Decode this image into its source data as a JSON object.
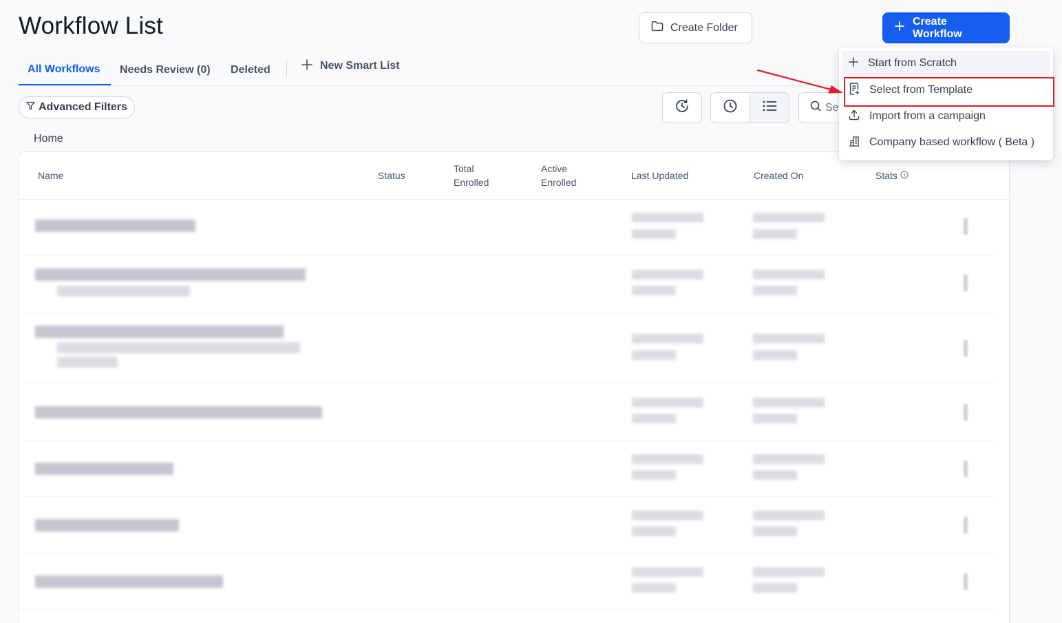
{
  "page": {
    "title": "Workflow List"
  },
  "actions": {
    "create_folder": "Create Folder",
    "create_workflow": "Create Workflow"
  },
  "tabs": [
    {
      "label": "All Workflows",
      "active": true
    },
    {
      "label": "Needs Review (0)",
      "active": false
    },
    {
      "label": "Deleted",
      "active": false
    },
    {
      "label": "New Smart List",
      "active": false
    }
  ],
  "filters": {
    "advanced": "Advanced Filters"
  },
  "search": {
    "visible_text": "Se"
  },
  "breadcrumb": {
    "home": "Home"
  },
  "table": {
    "columns": {
      "name": "Name",
      "status": "Status",
      "total_enrolled": "Total\nEnrolled",
      "active_enrolled": "Active\nEnrolled",
      "last_updated": "Last Updated",
      "created_on": "Created On",
      "stats": "Stats"
    },
    "rows_note_blurred": true
  },
  "dropdown": {
    "items": [
      {
        "label": "Start from Scratch",
        "icon": "plus-icon",
        "hovered": true
      },
      {
        "label": "Select from Template",
        "icon": "template-icon",
        "highlighted": true
      },
      {
        "label": "Import from a campaign",
        "icon": "upload-icon"
      },
      {
        "label": "Company based workflow ( Beta )",
        "icon": "building-icon"
      }
    ]
  },
  "colors": {
    "primary": "#155eef",
    "highlight": "#e01b2b",
    "text": "#101828"
  }
}
